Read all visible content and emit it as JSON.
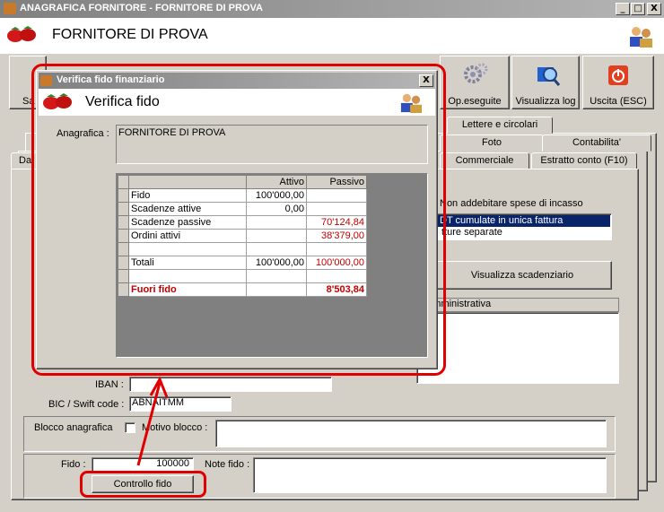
{
  "main_window": {
    "title": "ANAGRAFICA FORNITORE - FORNITORE DI PROVA",
    "header": "FORNITORE DI PROVA",
    "controls": [
      "_",
      "□",
      "X"
    ]
  },
  "toolbar": {
    "partial_left_label": "Sa",
    "op_eseguite": "Op.eseguite",
    "visualizza_log": "Visualizza log",
    "uscita": "Uscita (ESC)"
  },
  "tabs": {
    "row1": [
      "Lettere e circolari"
    ],
    "row2": [
      "Foto",
      "Contabilita'"
    ],
    "row3": [
      "Commerciale",
      "Estratto conto (F10)"
    ],
    "left_partial": "Da"
  },
  "right_panel": {
    "checkbox_label": "Non addebitare spese di incasso",
    "list_items": [
      "DT cumulate in unica fattura",
      "tture separate"
    ],
    "visualizza_scadenziario": "Visualizza scadenziario",
    "note_header": "e amministrativa"
  },
  "bottom_form": {
    "iban_label": "IBAN :",
    "iban_value": "",
    "bic_label": "BIC / Swift code :",
    "bic_value": "ABNAITMM",
    "blocco_label": "Blocco anagrafica",
    "motivo_label": "Motivo blocco :",
    "fido_label": "Fido :",
    "fido_value": "100000",
    "note_fido_label": "Note fido :",
    "controllo_fido": "Controllo fido"
  },
  "dialog": {
    "title": "Verifica fido finanziario",
    "header": "Verifica fido",
    "anagrafica_label": "Anagrafica :",
    "anagrafica_value": "FORNITORE DI PROVA",
    "table": {
      "headers": [
        "",
        "Attivo",
        "Passivo"
      ],
      "rows": [
        {
          "label": "Fido",
          "attivo": "100'000,00",
          "passivo": ""
        },
        {
          "label": "Scadenze attive",
          "attivo": "0,00",
          "passivo": ""
        },
        {
          "label": "Scadenze passive",
          "attivo": "",
          "passivo": "70'124,84"
        },
        {
          "label": "Ordini attivi",
          "attivo": "",
          "passivo": "38'379,00"
        },
        {
          "label": "",
          "attivo": "",
          "passivo": ""
        },
        {
          "label": "Totali",
          "attivo": "100'000,00",
          "passivo": "100'000,00"
        },
        {
          "label": "",
          "attivo": "",
          "passivo": ""
        },
        {
          "label": "Fuori fido",
          "attivo": "",
          "passivo": "8'503,84"
        }
      ]
    }
  },
  "colors": {
    "annotation_red": "#e00000",
    "negative_red": "#c00000",
    "selection_blue": "#0a246a"
  }
}
